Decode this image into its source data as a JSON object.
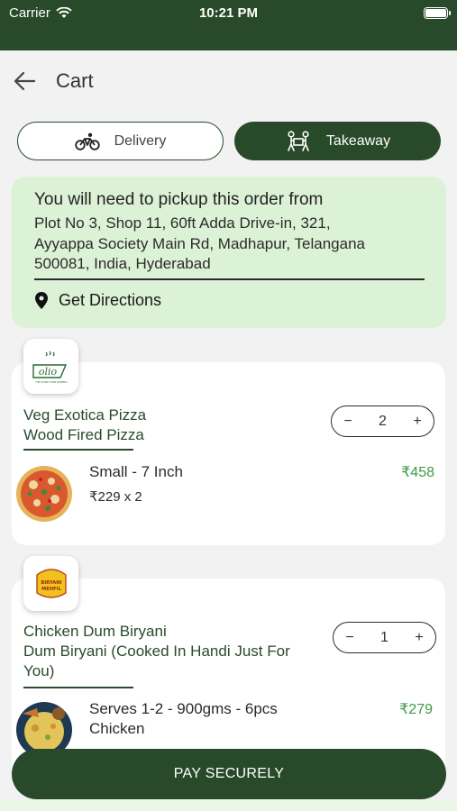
{
  "status_bar": {
    "carrier": "Carrier",
    "time": "10:21 PM"
  },
  "header": {
    "title": "Cart"
  },
  "mode_toggle": {
    "delivery_label": "Delivery",
    "takeaway_label": "Takeaway",
    "selected": "Takeaway"
  },
  "pickup": {
    "title": "You will need to pickup this order from",
    "address_lines": [
      "Plot No 3, Shop 11, 60ft Adda Drive-in, 321,",
      "Ayyappa Society Main Rd, Madhapur, Telangana",
      "500081, India, Hyderabad"
    ],
    "directions_label": "Get Directions"
  },
  "cart_items": [
    {
      "restaurant_logo_text": "olio",
      "restaurant_logo_subtext": "THE STONE OVEN PIZZERIA",
      "name_lines": [
        "Veg Exotica Pizza",
        "Wood Fired Pizza"
      ],
      "quantity": "2",
      "variant_lines": [
        "Small - 7 Inch"
      ],
      "unit_price": "₹229 x 2",
      "line_total": "₹458"
    },
    {
      "restaurant_logo_text": "BIRYANI MEHFIL",
      "name_lines": [
        "Chicken Dum Biryani",
        "Dum Biryani (Cooked In Handi Just For",
        "You)"
      ],
      "quantity": "1",
      "variant_lines": [
        "Serves 1-2 - 900gms - 6pcs",
        "Chicken"
      ],
      "line_total": "₹279"
    }
  ],
  "pay_button": {
    "label": "PAY SECURELY"
  },
  "colors": {
    "brand_green": "#284a2a",
    "accent_price": "#3c9b46",
    "pickup_bg": "#dcf2d6"
  }
}
